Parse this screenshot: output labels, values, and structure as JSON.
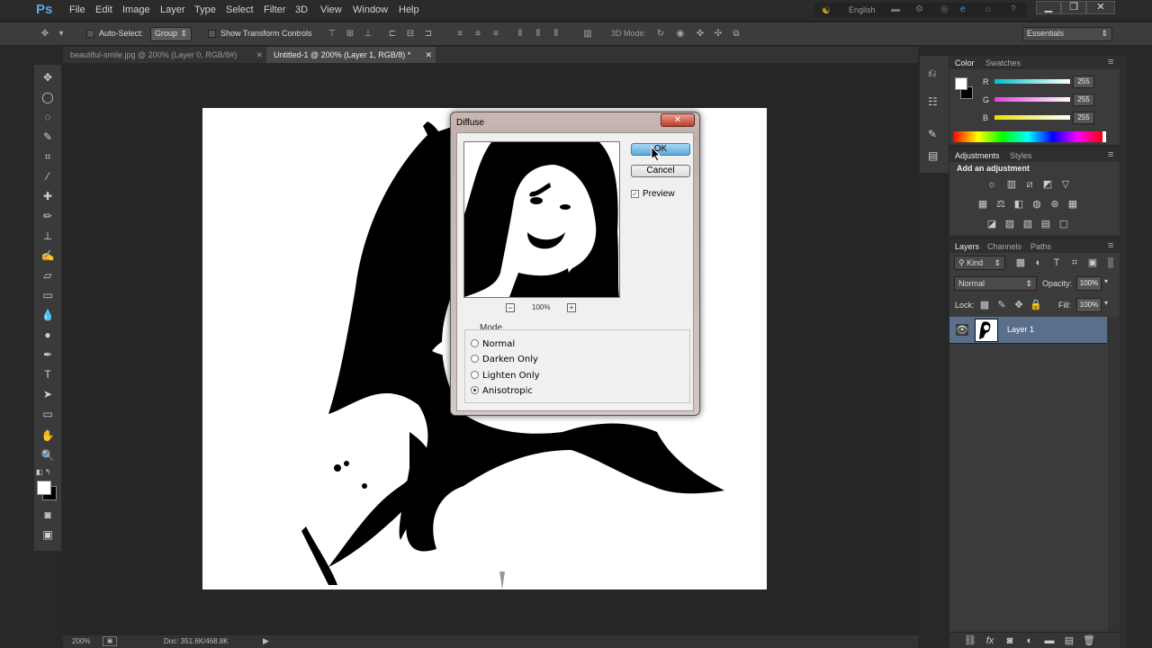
{
  "app": {
    "logo": "Ps"
  },
  "menu": [
    "File",
    "Edit",
    "Image",
    "Layer",
    "Type",
    "Select",
    "Filter",
    "3D",
    "View",
    "Window",
    "Help"
  ],
  "system": {
    "language": "English"
  },
  "options_bar": {
    "auto_select_label": "Auto-Select:",
    "auto_select_value": "Group",
    "show_transform_label": "Show Transform Controls",
    "mode_3d_label": "3D Mode:",
    "workspace": "Essentials"
  },
  "tabs": [
    {
      "label": "beautiful-smile.jpg @ 200% (Layer 0, RGB/8#)",
      "active": false
    },
    {
      "label": "Untitled-1 @ 200% (Layer 1, RGB/8) *",
      "active": true
    }
  ],
  "status": {
    "zoom": "200%",
    "doc": "Doc: 351.6K/468.8K"
  },
  "color_panel": {
    "tabs": [
      "Color",
      "Swatches"
    ],
    "channels": [
      {
        "label": "R",
        "value": "255",
        "color": "#00c0c8"
      },
      {
        "label": "G",
        "value": "255",
        "color": "#e040d8"
      },
      {
        "label": "B",
        "value": "255",
        "color": "#e8e000"
      }
    ]
  },
  "adjustments_panel": {
    "tabs": [
      "Adjustments",
      "Styles"
    ],
    "title": "Add an adjustment"
  },
  "layers_panel": {
    "tabs": [
      "Layers",
      "Channels",
      "Paths"
    ],
    "filter_label": "Kind",
    "blend_mode": "Normal",
    "opacity_label": "Opacity:",
    "opacity_value": "100%",
    "lock_label": "Lock:",
    "fill_label": "Fill:",
    "fill_value": "100%",
    "layers": [
      {
        "name": "Layer 1"
      }
    ]
  },
  "dialog": {
    "title": "Diffuse",
    "ok_label": "OK",
    "cancel_label": "Cancel",
    "preview_label": "Preview",
    "preview_checked": true,
    "zoom_value": "100%",
    "mode_group_label": "Mode",
    "modes": [
      {
        "label": "Normal",
        "selected": false
      },
      {
        "label": "Darken Only",
        "selected": false
      },
      {
        "label": "Lighten Only",
        "selected": false
      },
      {
        "label": "Anisotropic",
        "selected": true
      }
    ]
  }
}
